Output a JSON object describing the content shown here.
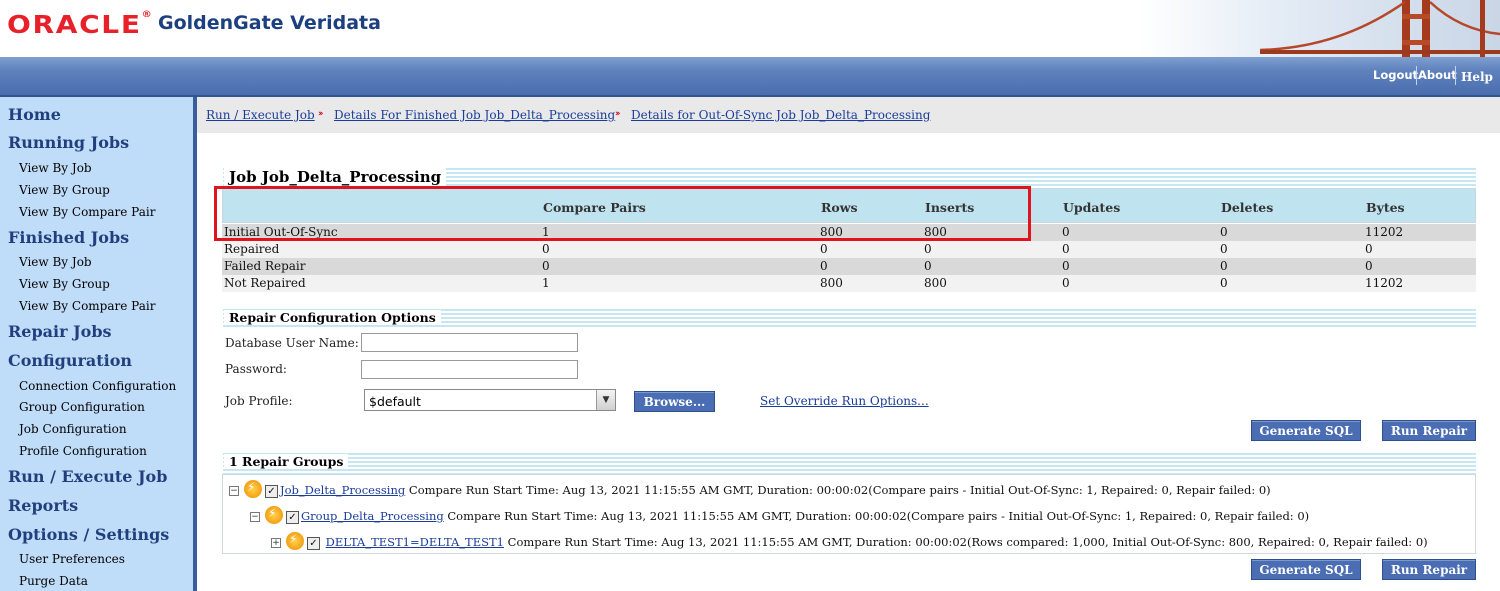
{
  "header": {
    "brand": "ORACLE",
    "product": "GoldenGate Veridata",
    "nav": {
      "logout": "Logout",
      "about": "About",
      "help": "Help"
    }
  },
  "sidebar": {
    "sections": [
      {
        "label": "Home",
        "items": []
      },
      {
        "label": "Running Jobs",
        "items": [
          "View By Job",
          "View By Group",
          "View By Compare Pair"
        ]
      },
      {
        "label": "Finished Jobs",
        "items": [
          "View By Job",
          "View By Group",
          "View By Compare Pair"
        ]
      },
      {
        "label": "Repair Jobs",
        "items": []
      },
      {
        "label": "Configuration",
        "items": [
          "Connection Configuration",
          "Group Configuration",
          "Job Configuration",
          "Profile Configuration"
        ]
      },
      {
        "label": "Run / Execute Job",
        "items": []
      },
      {
        "label": "Reports",
        "items": []
      },
      {
        "label": "Options / Settings",
        "items": [
          "User Preferences",
          "Purge Data"
        ]
      }
    ]
  },
  "breadcrumb": [
    "Run / Execute Job",
    "Details For Finished Job Job_Delta_Processing",
    "Details for Out-Of-Sync Job Job_Delta_Processing"
  ],
  "summary": {
    "title": "Job Job_Delta_Processing",
    "columns": [
      "",
      "Compare Pairs",
      "Rows",
      "Inserts",
      "Updates",
      "Deletes",
      "Bytes"
    ],
    "rows": [
      [
        "Initial Out-Of-Sync",
        "1",
        "800",
        "800",
        "0",
        "0",
        "11202"
      ],
      [
        "Repaired",
        "0",
        "0",
        "0",
        "0",
        "0",
        "0"
      ],
      [
        "Failed Repair",
        "0",
        "0",
        "0",
        "0",
        "0",
        "0"
      ],
      [
        "Not Repaired",
        "1",
        "800",
        "800",
        "0",
        "0",
        "11202"
      ]
    ]
  },
  "repair_config": {
    "title": "Repair Configuration Options",
    "db_user_label": "Database User Name:",
    "db_user_value": "",
    "password_label": "Password:",
    "password_value": "",
    "job_profile_label": "Job Profile:",
    "job_profile_value": "$default",
    "browse_label": "Browse...",
    "override_link": "Set Override Run Options..."
  },
  "actions": {
    "generate_sql": "Generate SQL",
    "run_repair": "Run Repair"
  },
  "repair_groups": {
    "title": "1 Repair Groups",
    "tree": [
      {
        "toggle": "−",
        "link": "Job_Delta_Processing",
        "text": " Compare Run Start Time: Aug 13, 2021 11:15:55 AM GMT, Duration: 00:00:02(Compare pairs - Initial Out-Of-Sync: 1, Repaired: 0, Repair failed: 0)"
      },
      {
        "toggle": "−",
        "link": "Group_Delta_Processing",
        "text": " Compare Run Start Time: Aug 13, 2021 11:15:55 AM GMT, Duration: 00:00:02(Compare pairs - Initial Out-Of-Sync: 1, Repaired: 0, Repair failed: 0)"
      },
      {
        "toggle": "+",
        "link": "DELTA_TEST1=DELTA_TEST1",
        "text": " Compare Run Start Time: Aug 13, 2021 11:15:55 AM GMT, Duration: 00:00:02(Rows compared: 1,000, Initial Out-Of-Sync: 800, Repaired: 0, Repair failed: 0)"
      }
    ]
  },
  "colors": {
    "highlight": "#e0141e",
    "nav_blue": "#4a6eae",
    "sidebar_bg": "#bfdcf9",
    "button_blue": "#4a6db4"
  }
}
